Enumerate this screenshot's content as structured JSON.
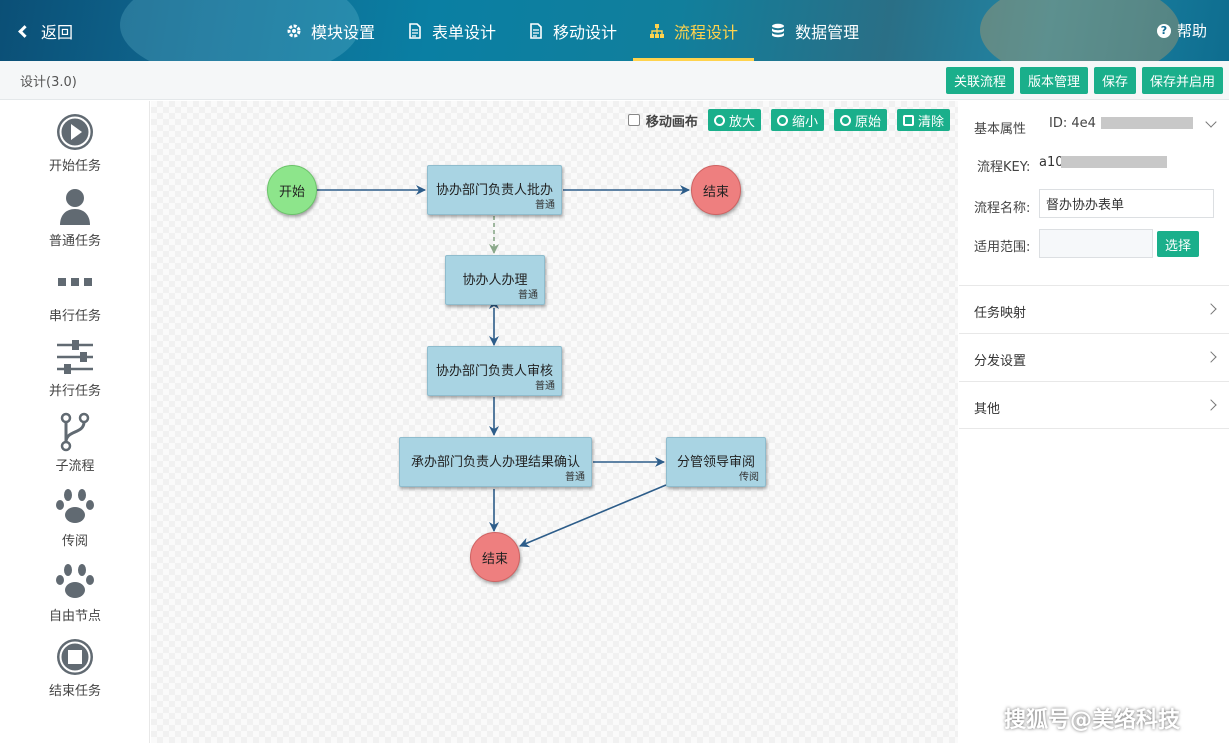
{
  "header": {
    "back_label": "返回",
    "help_label": "帮助",
    "tabs": [
      {
        "label": "模块设置",
        "icon": "gear-icon"
      },
      {
        "label": "表单设计",
        "icon": "document-icon"
      },
      {
        "label": "移动设计",
        "icon": "document-icon"
      },
      {
        "label": "流程设计",
        "icon": "sitemap-icon",
        "active": true
      },
      {
        "label": "数据管理",
        "icon": "database-icon"
      }
    ],
    "active_color": "#ffd34d"
  },
  "toolbar": {
    "version_label": "设计(3.0)",
    "buttons": [
      "关联流程",
      "版本管理",
      "保存",
      "保存并启用"
    ],
    "button_color": "#1aaf8b"
  },
  "palette": {
    "items": [
      {
        "label": "开始任务",
        "icon": "play-icon"
      },
      {
        "label": "普通任务",
        "icon": "user-icon"
      },
      {
        "label": "串行任务",
        "icon": "dots-icon"
      },
      {
        "label": "并行任务",
        "icon": "sliders-icon"
      },
      {
        "label": "子流程",
        "icon": "branch-icon"
      },
      {
        "label": "传阅",
        "icon": "paw-icon"
      },
      {
        "label": "自由节点",
        "icon": "paw-icon"
      },
      {
        "label": "结束任务",
        "icon": "stop-icon"
      }
    ]
  },
  "canvas": {
    "move_canvas_label": "移动画布",
    "tools": [
      "放大",
      "缩小",
      "原始",
      "清除"
    ],
    "start_label": "开始",
    "end_label": "结束",
    "nodes": [
      {
        "title": "协办部门负责人批办",
        "sub": "普通"
      },
      {
        "title": "协办人办理",
        "sub": "普通"
      },
      {
        "title": "协办部门负责人审核",
        "sub": "普通"
      },
      {
        "title": "承办部门负责人办理结果确认",
        "sub": "普通"
      },
      {
        "title": "分管领导审阅",
        "sub": "传阅"
      }
    ]
  },
  "properties": {
    "basic_label": "基本属性",
    "id_label": "ID: 4e4",
    "key_label": "流程KEY:",
    "key_value": "a10",
    "name_label": "流程名称:",
    "name_value": "督办协办表单",
    "scope_label": "适用范围:",
    "scope_value": "",
    "select_label": "选择",
    "sections": [
      "任务映射",
      "分发设置",
      "其他"
    ]
  },
  "watermark": "搜狐号@美络科技"
}
